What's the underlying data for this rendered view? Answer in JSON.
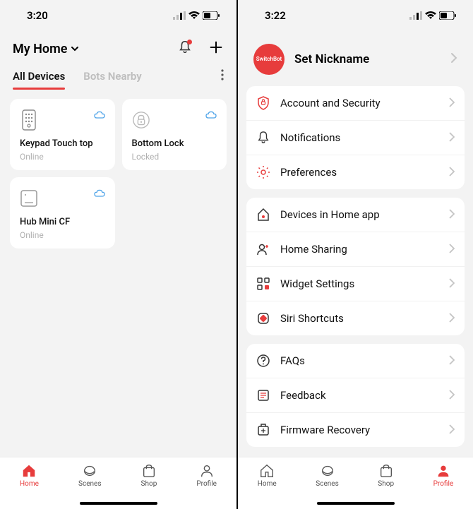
{
  "left": {
    "status_time": "3:20",
    "home_title": "My Home",
    "tabs": {
      "all": "All Devices",
      "nearby": "Bots Nearby"
    },
    "devices": [
      {
        "name": "Keypad Touch top",
        "status": "Online"
      },
      {
        "name": "Bottom Lock",
        "status": "Locked"
      },
      {
        "name": "Hub Mini CF",
        "status": "Online"
      }
    ],
    "nav": {
      "home": "Home",
      "scenes": "Scenes",
      "shop": "Shop",
      "profile": "Profile"
    }
  },
  "right": {
    "status_time": "3:22",
    "avatar_label": "SwitchBot",
    "nickname_title": "Set Nickname",
    "group1": [
      "Account and Security",
      "Notifications",
      "Preferences"
    ],
    "group2": [
      "Devices in Home app",
      "Home Sharing",
      "Widget Settings",
      "Siri Shortcuts"
    ],
    "group3": [
      "FAQs",
      "Feedback",
      "Firmware Recovery"
    ],
    "nav": {
      "home": "Home",
      "scenes": "Scenes",
      "shop": "Shop",
      "profile": "Profile"
    }
  },
  "colors": {
    "accent": "#e73c3c"
  }
}
